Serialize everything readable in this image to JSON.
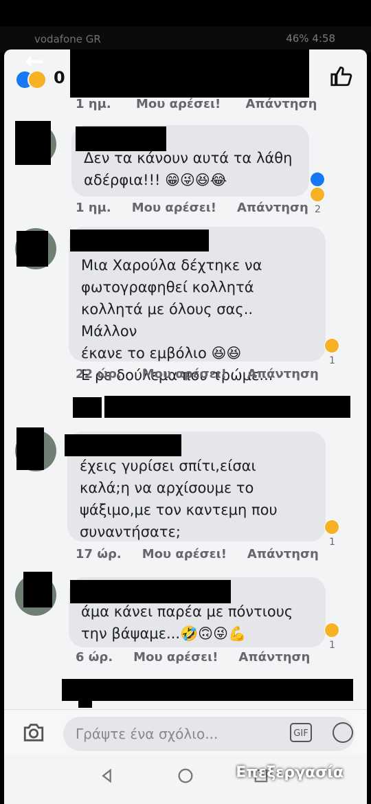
{
  "status": {
    "left": "vodafone GR",
    "right": "46% 4:58"
  },
  "header": {
    "reaction_count": "0",
    "back_label": "←"
  },
  "comments": [
    {
      "text": "Δεν τα κάνουν αυτά τα λάθη\nαδέρφια!!! 😁😜😆😂",
      "time": "1 ημ.",
      "like": "Μου αρέσει!",
      "reply": "Απάντηση",
      "reactions": "2"
    },
    {
      "text": "Μια Χαρούλα δέχτηκε να\nφωτογραφηθεί κολλητά\nκολλητά με όλους σας.. Μάλλον\nέκανε το εμβόλιο 😆😆\nΕ ρε δούλεμα που τρώμε...",
      "time": "22 ώρ.",
      "like": "Μου αρέσει!",
      "reply": "Απάντηση",
      "reactions": "1"
    },
    {
      "text": "έχεις γυρίσει σπίτι,είσαι\nκαλά;η να αρχίσουμε το\nψάξιμο,με τον καντεμη που\nσυναντήσατε;",
      "time": "17 ώρ.",
      "like": "Μου αρέσει!",
      "reply": "Απάντηση",
      "reactions": "1"
    },
    {
      "text": "άμα κάνει παρέα με πόντιους\nτην βάψαμε...🤣🙃😜💪",
      "time": "6 ώρ.",
      "like": "Μου αρέσει!",
      "reply": "Απάντηση",
      "reactions": "1"
    }
  ],
  "top_meta": {
    "time": "1 ημ.",
    "like": "Μου αρέσει!",
    "reply": "Απάντηση"
  },
  "composer": {
    "placeholder": "Γράψτε ένα σχόλιο...",
    "gif": "GIF"
  },
  "overlay": {
    "edit": "Επεξεργασία"
  }
}
